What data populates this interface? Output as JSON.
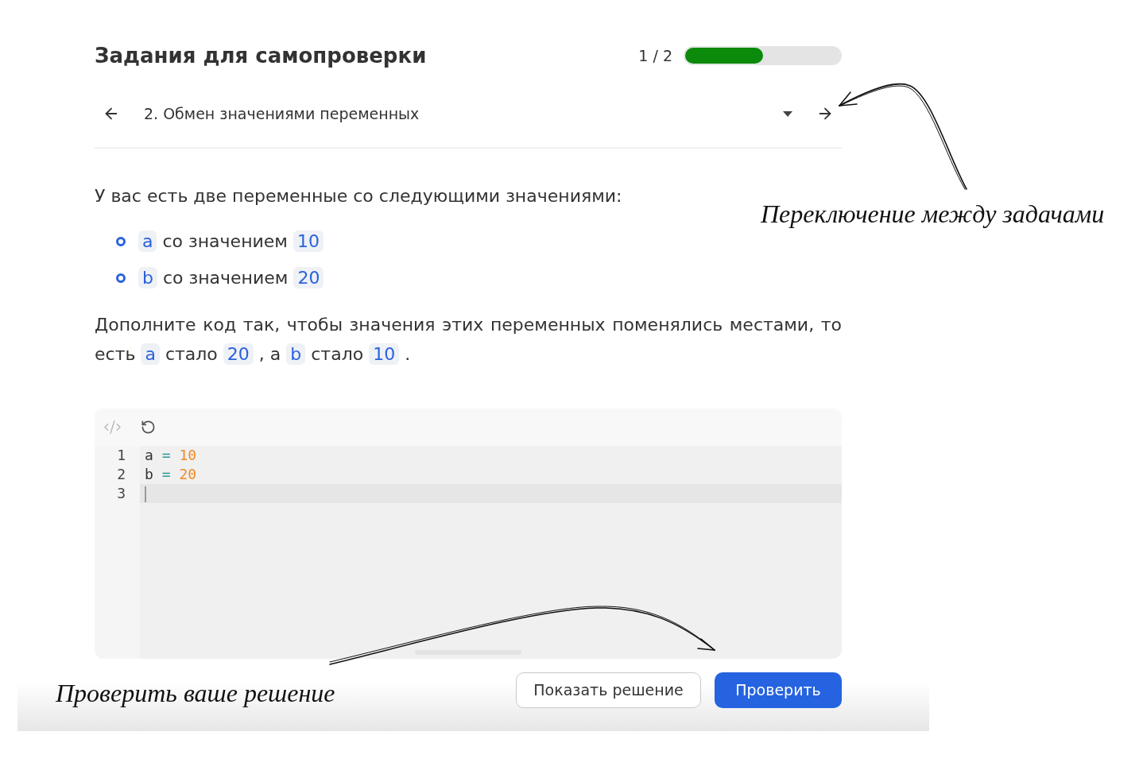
{
  "header": {
    "title": "Задания для самопроверки",
    "progress": {
      "text": "1 / 2",
      "level": 0.5
    }
  },
  "task_nav": {
    "task": "2. Обмен значениями переменных"
  },
  "task": {
    "intro": "У вас есть две переменные со следующими значениями:",
    "variables": [
      {
        "parts": [
          {
            "kind": "code",
            "text": "a"
          },
          {
            "kind": "text",
            "text": "со значением"
          },
          {
            "kind": "code",
            "text": "10"
          }
        ]
      },
      {
        "parts": [
          {
            "kind": "code",
            "text": "b"
          },
          {
            "kind": "text",
            "text": "со значением"
          },
          {
            "kind": "code",
            "text": "20"
          }
        ]
      }
    ],
    "instruction": [
      {
        "kind": "text",
        "text": "Дополните код так, чтобы значения этих переменных поменялись местами, то есть"
      },
      {
        "kind": "code",
        "text": "a"
      },
      {
        "kind": "text",
        "text": "стало"
      },
      {
        "kind": "code",
        "text": "20"
      },
      {
        "kind": "text",
        "text": ", а"
      },
      {
        "kind": "code",
        "text": "b"
      },
      {
        "kind": "text",
        "text": "стало"
      },
      {
        "kind": "code",
        "text": "10"
      },
      {
        "kind": "text",
        "text": "."
      }
    ]
  },
  "editor": {
    "lines": [
      {
        "number": "1",
        "active": false,
        "tokens": [
          {
            "kind": "name",
            "text": "a"
          },
          {
            "kind": "operator",
            "text": "="
          },
          {
            "kind": "number",
            "text": "10"
          }
        ]
      },
      {
        "number": "2",
        "active": false,
        "tokens": [
          {
            "kind": "name",
            "text": "b"
          },
          {
            "kind": "operator",
            "text": "="
          },
          {
            "kind": "number",
            "text": "20"
          }
        ]
      },
      {
        "number": "3",
        "active": true
      }
    ]
  },
  "buttons": [
    {
      "kind": "secondary",
      "label": "Показать решение"
    },
    {
      "kind": "primary",
      "label": "Проверить"
    }
  ],
  "annotations": [
    {
      "text": "Переключение между задачами"
    },
    {
      "text": "Проверить ваше решение"
    }
  ]
}
